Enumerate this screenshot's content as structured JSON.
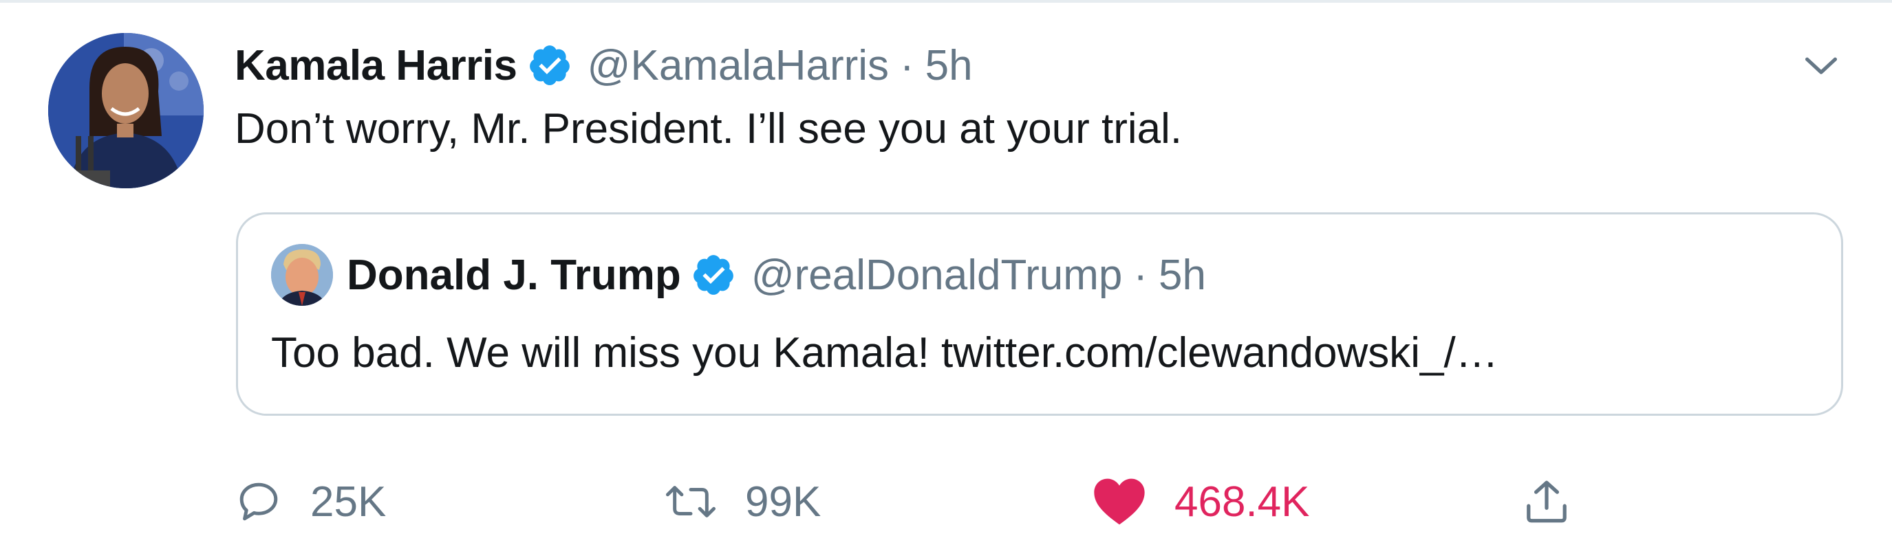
{
  "tweet": {
    "display_name": "Kamala Harris",
    "handle": "@KamalaHarris",
    "separator": "·",
    "time": "5h",
    "text": "Don’t worry, Mr. President. I’ll see you at your trial.",
    "avatar_icon": "profile-photo-kamala-harris",
    "verified_icon": "verified-badge-icon",
    "menu_icon": "chevron-down-icon"
  },
  "quoted_tweet": {
    "display_name": "Donald J. Trump",
    "handle": "@realDonaldTrump",
    "separator": "·",
    "time": "5h",
    "text": "Too bad. We will miss you Kamala! twitter.com/clewandowski_/…",
    "avatar_icon": "profile-photo-donald-trump",
    "verified_icon": "verified-badge-icon"
  },
  "actions": {
    "reply": {
      "icon": "reply-icon",
      "count": "25K"
    },
    "retweet": {
      "icon": "retweet-icon",
      "count": "99K"
    },
    "like": {
      "icon": "heart-icon",
      "count": "468.4K",
      "liked": true
    },
    "share": {
      "icon": "share-icon"
    }
  },
  "colors": {
    "text_primary": "#14171a",
    "text_secondary": "#657786",
    "verified_blue": "#1da1f2",
    "like_pink": "#e0245e",
    "border": "#ccd6dd"
  }
}
